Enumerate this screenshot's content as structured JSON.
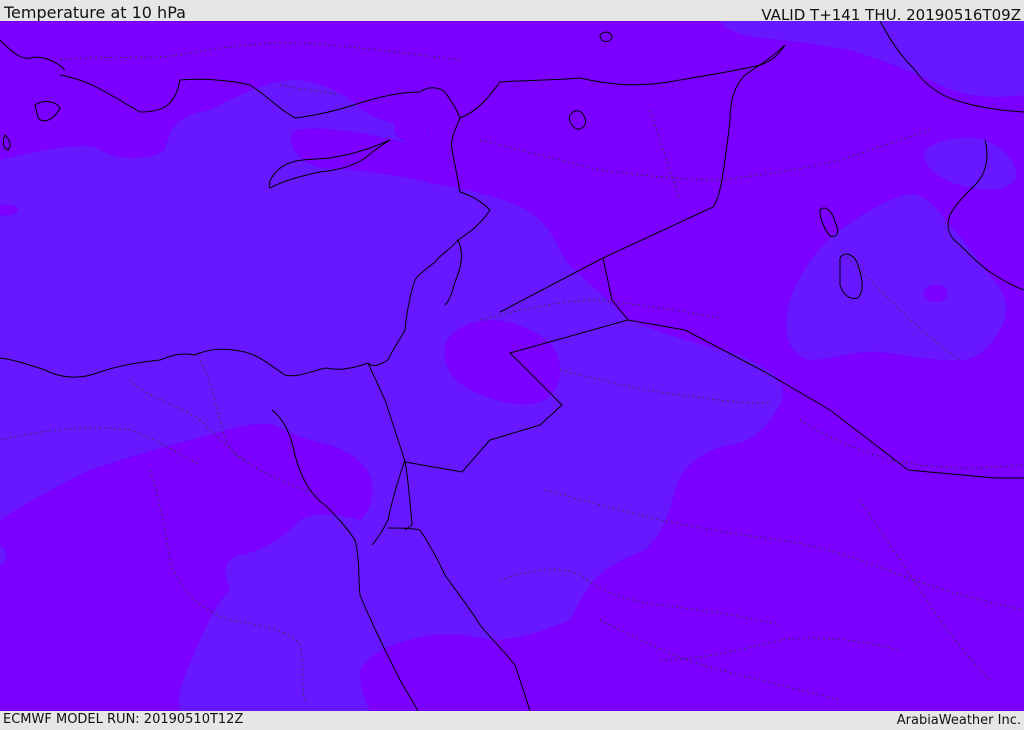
{
  "header": {
    "title": "Temperature at 10 hPa",
    "valid": "VALID T+141 THU. 20190516T09Z"
  },
  "footer": {
    "model_run": "ECMWF MODEL RUN: 20190510T12Z",
    "credit": "ArabiaWeather Inc."
  },
  "map": {
    "field_colors": {
      "warmer": "#7b00ff",
      "cooler": "#6718ff"
    },
    "coastline_color": "#000000",
    "border_style": "dotted"
  }
}
